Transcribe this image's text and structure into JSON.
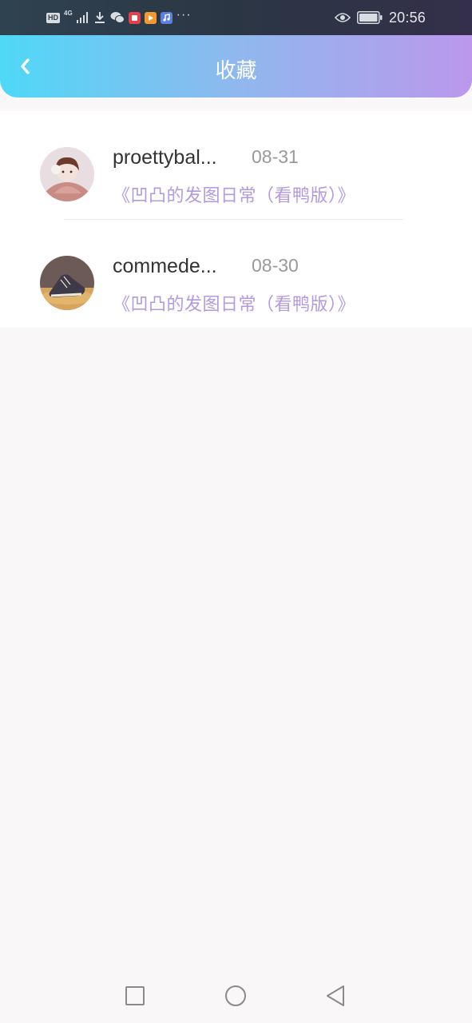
{
  "status_bar": {
    "network": "HD",
    "network_type": "4G",
    "more": "···",
    "time": "20:56",
    "icons": [
      "hd-icon",
      "signal-icon",
      "download-icon",
      "wechat-icon",
      "app-red-icon",
      "app-orange-icon",
      "app-music-icon",
      "eye-icon",
      "battery-icon"
    ]
  },
  "header": {
    "title": "收藏",
    "back_icon": "chevron-left-icon"
  },
  "favorites": [
    {
      "username": "proettybal...",
      "date": "08-31",
      "work_title": "《凹凸的发图日常（看鸭版）》"
    },
    {
      "username": "commede...",
      "date": "08-30",
      "work_title": "《凹凸的发图日常（看鸭版）》"
    }
  ],
  "nav_bar": {
    "buttons": [
      "recent-apps-icon",
      "home-icon",
      "back-icon"
    ]
  },
  "colors": {
    "header_gradient_start": "#4fd8f7",
    "header_gradient_end": "#bb98ec",
    "work_title": "#b39ae0",
    "date": "#999999",
    "username": "#333333",
    "background": "#f9f7f8"
  }
}
